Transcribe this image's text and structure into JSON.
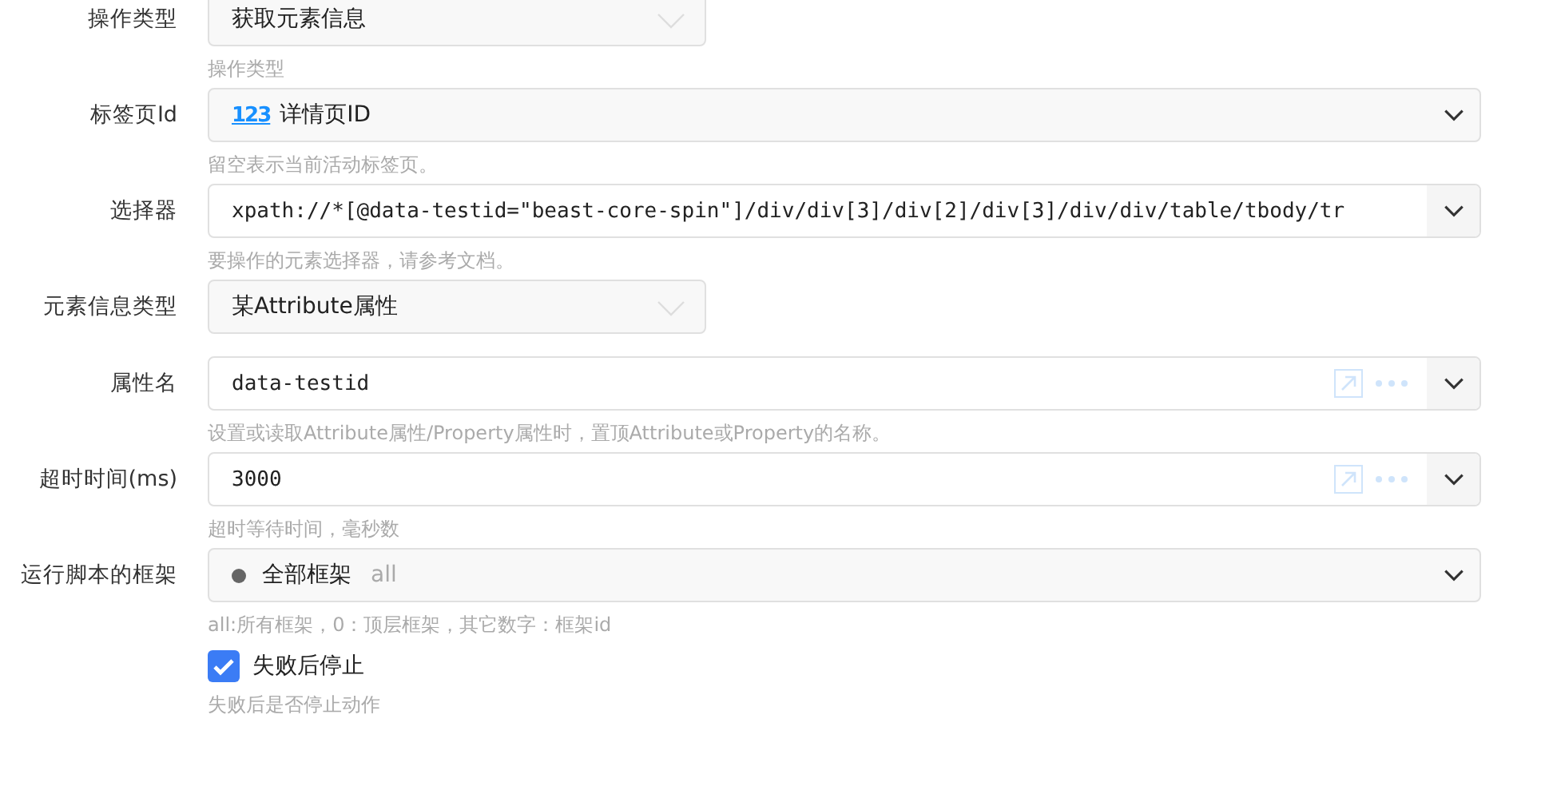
{
  "fields": [
    {
      "label": "操作类型",
      "kind": "select",
      "value": "获取元素信息",
      "hint": "操作类型"
    },
    {
      "label": "标签页Id",
      "kind": "combo",
      "badge": "123",
      "value": "详情页ID",
      "hint": "留空表示当前活动标签页。"
    },
    {
      "label": "选择器",
      "kind": "input",
      "value": "xpath://*[@data-testid=\"beast-core-spin\"]/div/div[3]/div[2]/div[3]/div/div/table/tbody/tr",
      "actions": false,
      "hint": "要操作的元素选择器，请参考文档。"
    },
    {
      "label": "元素信息类型",
      "kind": "select",
      "value": "某Attribute属性"
    },
    {
      "label": "属性名",
      "kind": "input",
      "value": "data-testid",
      "actions": true,
      "hint": "设置或读取Attribute属性/Property属性时，置顶Attribute或Property的名称。"
    },
    {
      "label": "超时时间(ms)",
      "kind": "input",
      "value": "3000",
      "actions": true,
      "hint": "超时等待时间，毫秒数"
    },
    {
      "label": "运行脚本的框架",
      "kind": "combo",
      "dot": true,
      "value": "全部框架",
      "secondary": "all",
      "hint": "all:所有框架，0：顶层框架，其它数字：框架id"
    }
  ],
  "stop_on_failure": {
    "label": "失败后停止",
    "checked": true,
    "hint": "失败后是否停止动作"
  }
}
